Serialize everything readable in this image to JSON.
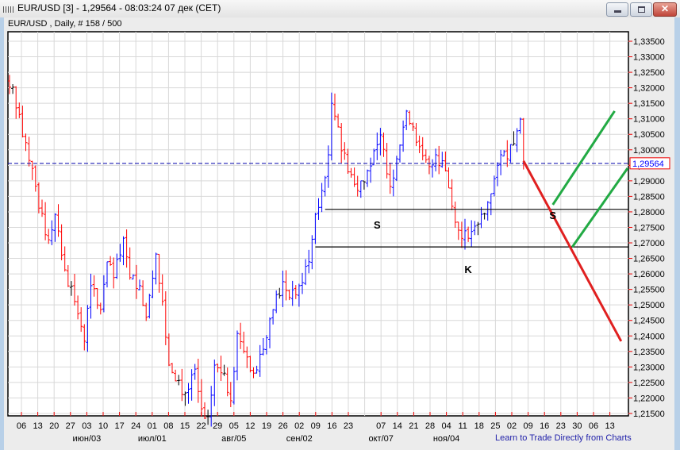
{
  "window": {
    "title": "EUR/USD [3] - 1,29564 - 08:03:24  07 дек (CET)",
    "buttons": {
      "minimize": "minimize",
      "maximize": "maximize",
      "close": "✕"
    }
  },
  "chart_header": "EUR/USD , Daily, # 158 / 500",
  "learn_link": "Learn to Trade Directly from Charts",
  "colors": {
    "up": "#0000ff",
    "down": "#ff0000",
    "neutral": "#000000",
    "grid": "#d8d8d8",
    "green_line": "#22aa44",
    "red_line": "#e02020",
    "price_tag": "#0000ff"
  },
  "chart_data": {
    "type": "ohlc-bar",
    "symbol": "EUR/USD",
    "timeframe": "Daily",
    "current_price": 1.29564,
    "current_price_label": "1,29564",
    "ylim": [
      1.2125,
      1.3375
    ],
    "y_ticks": [
      "1,33500",
      "1,33000",
      "1,32500",
      "1,32000",
      "1,31500",
      "1,31000",
      "1,30500",
      "1,30000",
      "1,29500",
      "1,29000",
      "1,28500",
      "1,28000",
      "1,27500",
      "1,27000",
      "1,26500",
      "1,26000",
      "1,25500",
      "1,25000",
      "1,24500",
      "1,24000",
      "1,23500",
      "1,23000",
      "1,22500",
      "1,22000",
      "1,21500"
    ],
    "x_week_labels": [
      "06",
      "13",
      "20",
      "27",
      "03",
      "10",
      "17",
      "24",
      "01",
      "08",
      "15",
      "22",
      "29",
      "05",
      "12",
      "19",
      "26",
      "02",
      "09",
      "16",
      "23",
      "",
      "07",
      "14",
      "21",
      "28",
      "04",
      "11",
      "18",
      "25",
      "02",
      "09",
      "16",
      "23",
      "30",
      "06",
      "13"
    ],
    "x_month_labels": [
      {
        "week": 4,
        "label": "июн/03"
      },
      {
        "week": 8,
        "label": "июл/01"
      },
      {
        "week": 13,
        "label": "авг/05"
      },
      {
        "week": 17,
        "label": "сен/02"
      },
      {
        "week": 22,
        "label": "окт/07"
      },
      {
        "week": 26,
        "label": "ноя/04"
      }
    ],
    "close_keypoints": [
      [
        0,
        1.3202
      ],
      [
        1,
        1.3202
      ],
      [
        4,
        1.3043
      ],
      [
        7,
        1.294
      ],
      [
        9,
        1.2812
      ],
      [
        12,
        1.271
      ],
      [
        14,
        1.2792
      ],
      [
        17,
        1.2613
      ],
      [
        20,
        1.2511
      ],
      [
        23,
        1.2383
      ],
      [
        25,
        1.2562
      ],
      [
        28,
        1.2485
      ],
      [
        30,
        1.2639
      ],
      [
        32,
        1.2588
      ],
      [
        35,
        1.2715
      ],
      [
        37,
        1.2588
      ],
      [
        40,
        1.2562
      ],
      [
        42,
        1.246
      ],
      [
        45,
        1.2664
      ],
      [
        47,
        1.2511
      ],
      [
        49,
        1.2306
      ],
      [
        51,
        1.2255
      ],
      [
        54,
        1.2216
      ],
      [
        57,
        1.2293
      ],
      [
        59,
        1.2165
      ],
      [
        61,
        1.214
      ],
      [
        63,
        1.2306
      ],
      [
        66,
        1.228
      ],
      [
        68,
        1.2191
      ],
      [
        70,
        1.2408
      ],
      [
        73,
        1.2332
      ],
      [
        75,
        1.228
      ],
      [
        78,
        1.2357
      ],
      [
        81,
        1.2485
      ],
      [
        84,
        1.2575
      ],
      [
        86,
        1.2524
      ],
      [
        89,
        1.2562
      ],
      [
        92,
        1.2639
      ],
      [
        94,
        1.2792
      ],
      [
        96,
        1.2869
      ],
      [
        98,
        1.2984
      ],
      [
        99,
        1.315
      ],
      [
        101,
        1.3074
      ],
      [
        102,
        1.2997
      ],
      [
        105,
        1.292
      ],
      [
        107,
        1.2869
      ],
      [
        110,
        1.2933
      ],
      [
        112,
        1.2997
      ],
      [
        114,
        1.3048
      ],
      [
        117,
        1.2882
      ],
      [
        119,
        1.2971
      ],
      [
        122,
        1.3125
      ],
      [
        124,
        1.3074
      ],
      [
        126,
        1.301
      ],
      [
        129,
        1.2946
      ],
      [
        131,
        1.2984
      ],
      [
        134,
        1.2933
      ],
      [
        136,
        1.2818
      ],
      [
        138,
        1.2741
      ],
      [
        141,
        1.2715
      ],
      [
        143,
        1.2754
      ],
      [
        145,
        1.2792
      ],
      [
        147,
        1.2831
      ],
      [
        149,
        1.2907
      ],
      [
        151,
        1.2984
      ],
      [
        153,
        1.2971
      ],
      [
        156,
        1.3061
      ],
      [
        157,
        1.3099
      ],
      [
        158,
        1.29564
      ]
    ],
    "horizontal_levels": [
      {
        "price": 1.2808,
        "from_bar": 97
      },
      {
        "price": 1.2687,
        "from_bar": 94
      }
    ],
    "projection_lines": [
      {
        "color": "red",
        "from": [
          158,
          1.2964
        ],
        "to": [
          188,
          1.2383
        ]
      },
      {
        "color": "green",
        "from": [
          167,
          1.2823
        ],
        "to": [
          186,
          1.3125
        ]
      },
      {
        "color": "green",
        "from": [
          173,
          1.2687
        ],
        "to": [
          190,
          1.2941
        ]
      }
    ],
    "annotations": [
      {
        "text": "S",
        "bar": 113,
        "price": 1.2746
      },
      {
        "text": "K",
        "bar": 141,
        "price": 1.2603
      },
      {
        "text": "S",
        "bar": 167,
        "price": 1.2777
      }
    ]
  }
}
